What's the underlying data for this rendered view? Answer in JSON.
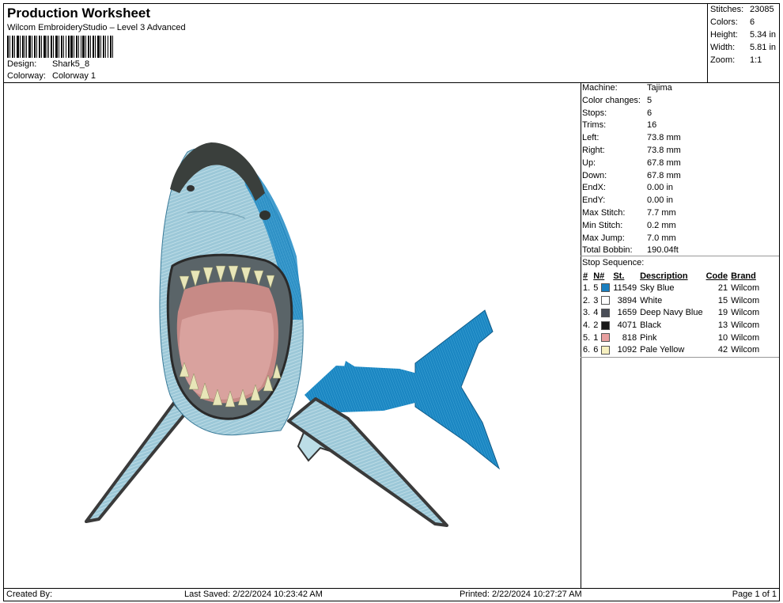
{
  "header": {
    "title": "Production Worksheet",
    "subtitle": "Wilcom EmbroideryStudio – Level 3 Advanced",
    "design_label": "Design:",
    "design_value": "Shark5_8",
    "colorway_label": "Colorway:",
    "colorway_value": "Colorway 1"
  },
  "stats": {
    "stitches_label": "Stitches:",
    "stitches_value": "23085",
    "colors_label": "Colors:",
    "colors_value": "6",
    "height_label": "Height:",
    "height_value": "5.34 in",
    "width_label": "Width:",
    "width_value": "5.81 in",
    "zoom_label": "Zoom:",
    "zoom_value": "1:1"
  },
  "machine": [
    {
      "label": "Machine:",
      "value": "Tajima"
    },
    {
      "label": "Color changes:",
      "value": "5"
    },
    {
      "label": "Stops:",
      "value": "6"
    },
    {
      "label": "Trims:",
      "value": "16"
    },
    {
      "label": "Left:",
      "value": "73.8 mm"
    },
    {
      "label": "Right:",
      "value": "73.8 mm"
    },
    {
      "label": "Up:",
      "value": "67.8 mm"
    },
    {
      "label": "Down:",
      "value": "67.8 mm"
    },
    {
      "label": "EndX:",
      "value": "0.00 in"
    },
    {
      "label": "EndY:",
      "value": "0.00 in"
    },
    {
      "label": "Max Stitch:",
      "value": "7.7 mm"
    },
    {
      "label": "Min Stitch:",
      "value": "0.2 mm"
    },
    {
      "label": "Max Jump:",
      "value": "7.0 mm"
    },
    {
      "label": "Total Bobbin:",
      "value": "190.04ft"
    }
  ],
  "sequence": {
    "title": "Stop Sequence:",
    "columns": [
      "#",
      "N#",
      "St.",
      "Description",
      "Code",
      "Brand"
    ],
    "rows": [
      {
        "idx": "1.",
        "n": "5",
        "color": "#1a7fc0",
        "st": "11549",
        "desc": "Sky Blue",
        "code": "21",
        "brand": "Wilcom"
      },
      {
        "idx": "2.",
        "n": "3",
        "color": "#ffffff",
        "st": "3894",
        "desc": "White",
        "code": "15",
        "brand": "Wilcom"
      },
      {
        "idx": "3.",
        "n": "4",
        "color": "#4a4e58",
        "st": "1659",
        "desc": "Deep Navy Blue",
        "code": "19",
        "brand": "Wilcom"
      },
      {
        "idx": "4.",
        "n": "2",
        "color": "#1a1a1a",
        "st": "4071",
        "desc": "Black",
        "code": "13",
        "brand": "Wilcom"
      },
      {
        "idx": "5.",
        "n": "1",
        "color": "#e8a0a0",
        "st": "818",
        "desc": "Pink",
        "code": "10",
        "brand": "Wilcom"
      },
      {
        "idx": "6.",
        "n": "6",
        "color": "#f6f0c0",
        "st": "1092",
        "desc": "Pale Yellow",
        "code": "42",
        "brand": "Wilcom"
      }
    ]
  },
  "footer": {
    "created_by": "Created By:",
    "last_saved": "Last Saved: 2/22/2024 10:23:42 AM",
    "printed": "Printed: 2/22/2024 10:27:27 AM",
    "page": "Page 1 of 1"
  }
}
